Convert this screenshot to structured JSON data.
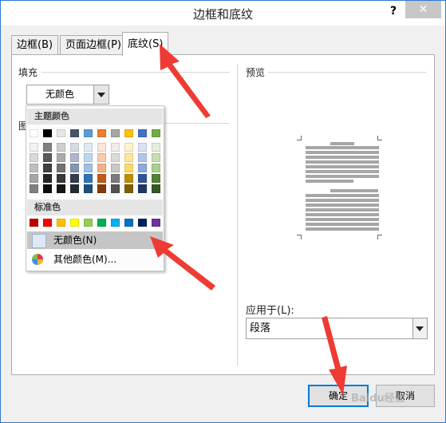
{
  "dialog": {
    "title": "边框和底纹",
    "help_label": "?",
    "close_label": "✕"
  },
  "tabs": [
    {
      "label": "边框(B)",
      "active": false
    },
    {
      "label": "页面边框(P)",
      "active": false
    },
    {
      "label": "底纹(S)",
      "active": true
    }
  ],
  "fill": {
    "section_label": "填充",
    "selected_value": "无颜色"
  },
  "pattern": {
    "section_label": "图"
  },
  "color_popup": {
    "theme_header": "主题颜色",
    "theme_colors_top": [
      "#ffffff",
      "#000000",
      "#e7e6e6",
      "#44546a",
      "#5b9bd5",
      "#ed7d31",
      "#a5a5a5",
      "#ffc000",
      "#4472c4",
      "#70ad47"
    ],
    "theme_shades": [
      [
        "#f2f2f2",
        "#d9d9d9",
        "#bfbfbf",
        "#a6a6a6",
        "#808080"
      ],
      [
        "#808080",
        "#595959",
        "#404040",
        "#262626",
        "#0d0d0d"
      ],
      [
        "#d0cece",
        "#aeaaaa",
        "#757070",
        "#3a3838",
        "#171616"
      ],
      [
        "#d6dce4",
        "#adb9ca",
        "#8497b0",
        "#333f4f",
        "#222a35"
      ],
      [
        "#ddebf7",
        "#bdd7ee",
        "#9bc2e6",
        "#2e75b6",
        "#1f4e79"
      ],
      [
        "#fce4d6",
        "#f8cbad",
        "#f4b084",
        "#c65911",
        "#843c0c"
      ],
      [
        "#ededed",
        "#dbdbdb",
        "#c9c9c9",
        "#7b7b7b",
        "#525252"
      ],
      [
        "#fff2cc",
        "#ffe699",
        "#ffd966",
        "#bf8f00",
        "#7f6000"
      ],
      [
        "#d9e1f2",
        "#b4c6e7",
        "#8ea9db",
        "#2f5597",
        "#203764"
      ],
      [
        "#e2efda",
        "#c6e0b4",
        "#a9d08e",
        "#548235",
        "#375623"
      ]
    ],
    "standard_header": "标准色",
    "standard_colors": [
      "#c00000",
      "#ff0000",
      "#ffc000",
      "#ffff00",
      "#92d050",
      "#00b050",
      "#00b0f0",
      "#0070c0",
      "#002060",
      "#7030a0"
    ],
    "no_color_label": "无颜色(N)",
    "more_colors_label": "其他颜色(M)..."
  },
  "preview": {
    "section_label": "预览"
  },
  "apply_to": {
    "label": "应用于(L):",
    "value": "段落"
  },
  "buttons": {
    "ok_label": "确定",
    "cancel_label": "取消"
  },
  "watermark": "Baidu经验"
}
